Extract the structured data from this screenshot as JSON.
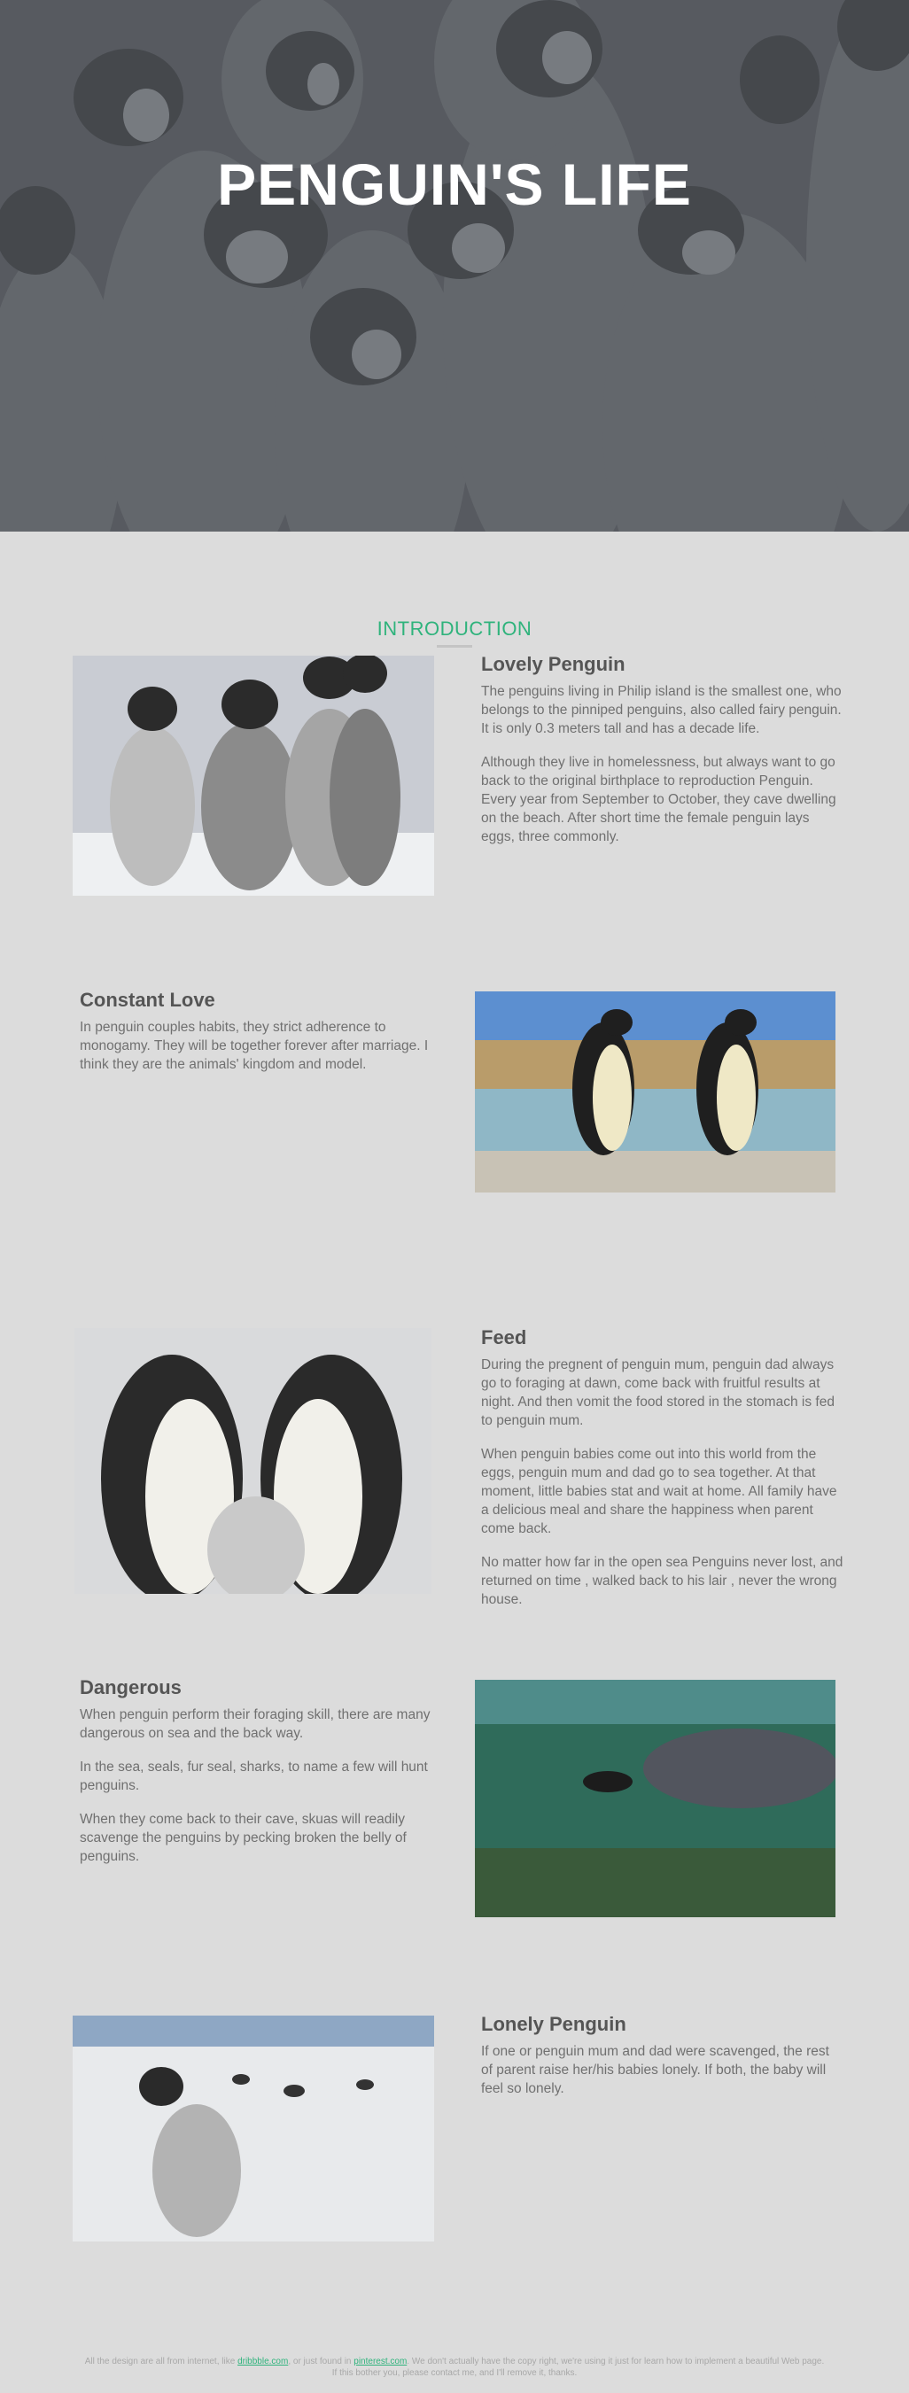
{
  "hero": {
    "title": "PENGUIN'S LIFE"
  },
  "intro": {
    "heading": "INTRODUCTION"
  },
  "sections": [
    {
      "title": "Lovely Penguin",
      "paragraphs": [
        "The penguins living in Philip island is the smallest one, who belongs to the pinniped penguins, also called fairy penguin. It is only 0.3 meters tall and has a decade life.",
        "Although they live in homelessness, but always want to go back to the original birthplace to reproduction Penguin. Every year from September to October, they cave dwelling on the beach. After short time the female penguin lays eggs, three commonly."
      ]
    },
    {
      "title": "Constant Love",
      "paragraphs": [
        "In penguin couples habits, they strict adherence to monogamy. They will be together forever after marriage. I think they are the animals' kingdom and model."
      ]
    },
    {
      "title": "Feed",
      "paragraphs": [
        "During the pregnent of penguin mum, penguin dad always go to foraging at dawn, come back with fruitful results at night. And then vomit the food stored in the stomach is fed to penguin mum.",
        "When penguin babies come out into this world from the eggs, penguin mum and dad go to sea together. At that moment, little babies stat and wait at home. All family have a delicious meal and share the happiness when parent come back.",
        "No matter how far in the open sea Penguins never lost, and returned on time , walked back to his lair , never the wrong house."
      ]
    },
    {
      "title": "Dangerous",
      "paragraphs": [
        "When penguin perform their foraging skill, there are many dangerous on sea and the back way.",
        "In the sea, seals, fur seal, sharks, to name a few will hunt penguins.",
        "When they come back to their cave, skuas will readily scavenge the penguins by pecking broken the belly of penguins."
      ]
    },
    {
      "title": "Lonely Penguin",
      "paragraphs": [
        "If one or penguin mum and dad were scavenged, the rest of parent raise her/his babies lonely. If both, the baby will feel so lonely."
      ]
    }
  ],
  "footer": {
    "pre": "All the design are all from internet, like ",
    "link1": "dribbble.com",
    "mid": ", or just found in ",
    "link2": "pinterest.com",
    "post": ". We don't actually have the copy right, we're using it just for learn how to implement a beautiful Web page.",
    "line2": "If this bother you, please contact me, and I'll remove it, thanks."
  },
  "colors": {
    "accent": "#2fb37c",
    "background": "#dcdcdc",
    "hero_overlay": "#5a5e63"
  }
}
